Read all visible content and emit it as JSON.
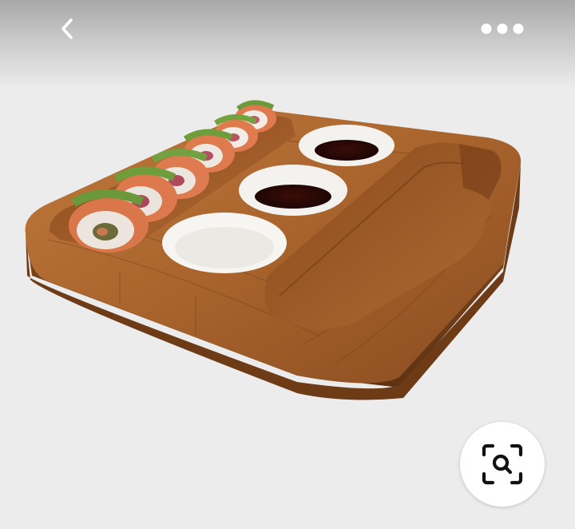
{
  "icons": {
    "back": "chevron-left-icon",
    "more": "more-horizontal-icon",
    "lens": "visual-search-icon"
  },
  "colors": {
    "background": "#ececec",
    "icon_light": "#ffffff",
    "icon_dark": "#111111",
    "wood": "#9b5a2c"
  }
}
